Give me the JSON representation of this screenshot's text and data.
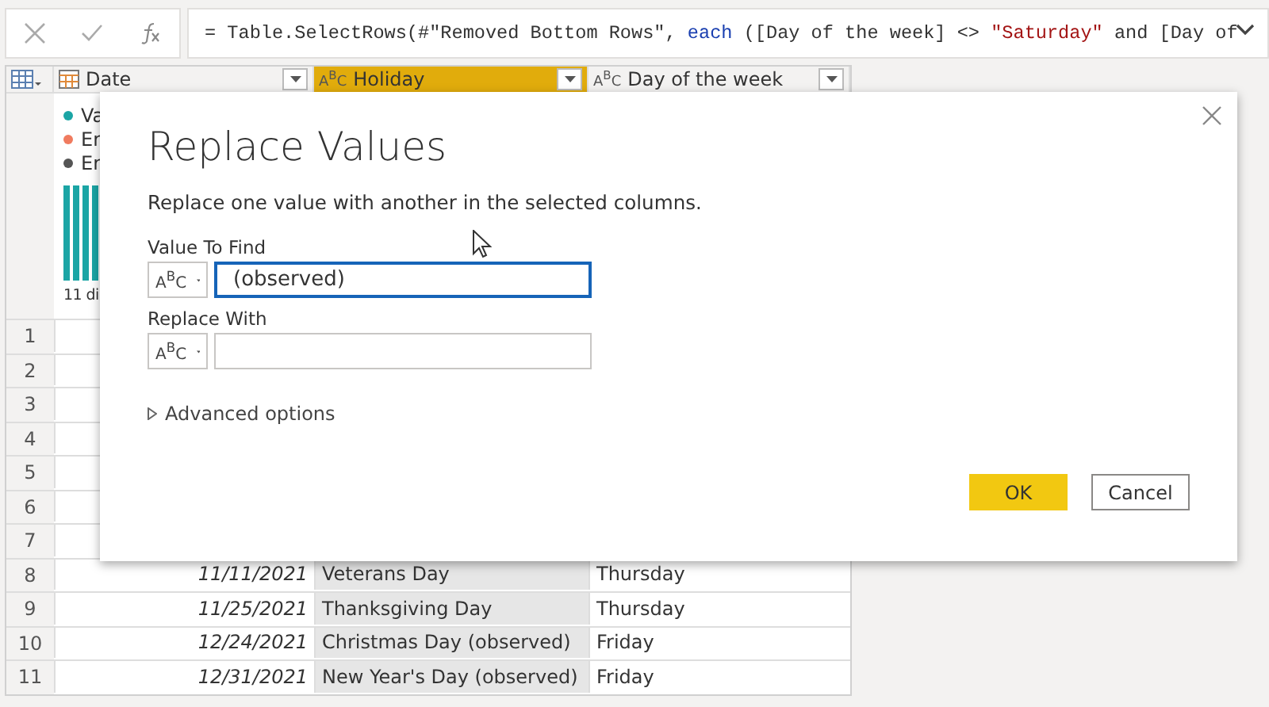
{
  "formula_bar": {
    "tokens": [
      {
        "kind": "plain",
        "text": "= Table.SelectRows(#\"Removed Bottom Rows\", "
      },
      {
        "kind": "keyword",
        "text": "each"
      },
      {
        "kind": "plain",
        "text": " ([Day of the week] <> "
      },
      {
        "kind": "string",
        "text": "\"Saturday\""
      },
      {
        "kind": "plain",
        "text": " and [Day of"
      }
    ]
  },
  "table": {
    "columns": [
      {
        "name": "Date",
        "kind": "date",
        "selected": false
      },
      {
        "name": "Holiday",
        "kind": "text",
        "type_label": "A$^{B}$C",
        "selected": true
      },
      {
        "name": "Day of the week",
        "kind": "text",
        "type_label": "A$^{B}$C",
        "selected": false
      }
    ],
    "profile": {
      "legend": [
        {
          "label": "Va",
          "color": "#1ba5a5"
        },
        {
          "label": "Er",
          "color": "#f07b5f"
        },
        {
          "label": "Er",
          "color": "#555555"
        }
      ],
      "summary": "11 di"
    },
    "rows": [
      {
        "number": "1"
      },
      {
        "number": "2"
      },
      {
        "number": "3"
      },
      {
        "number": "4"
      },
      {
        "number": "5"
      },
      {
        "number": "6"
      },
      {
        "number": "7"
      },
      {
        "number": "8",
        "cells": [
          "11/11/2021",
          "Veterans Day",
          "Thursday"
        ]
      },
      {
        "number": "9",
        "cells": [
          "11/25/2021",
          "Thanksgiving Day",
          "Thursday"
        ]
      },
      {
        "number": "10",
        "cells": [
          "12/24/2021",
          "Christmas Day (observed)",
          "Friday"
        ]
      },
      {
        "number": "11",
        "cells": [
          "12/31/2021",
          "New Year's Day (observed)",
          "Friday"
        ]
      }
    ]
  },
  "dialog": {
    "title": "Replace Values",
    "description": "Replace one value with another in the selected columns.",
    "fields": [
      {
        "label": "Value To Find",
        "type_label": "A$^{B}$C",
        "value": "(observed)",
        "focused": true
      },
      {
        "label": "Replace With",
        "type_label": "A$^{B}$C",
        "focused": false
      }
    ],
    "advanced_options": {
      "label": "Advanced options",
      "expanded": false
    },
    "buttons": [
      {
        "label": "OK",
        "primary": true
      },
      {
        "label": "Cancel",
        "primary": false
      }
    ]
  }
}
